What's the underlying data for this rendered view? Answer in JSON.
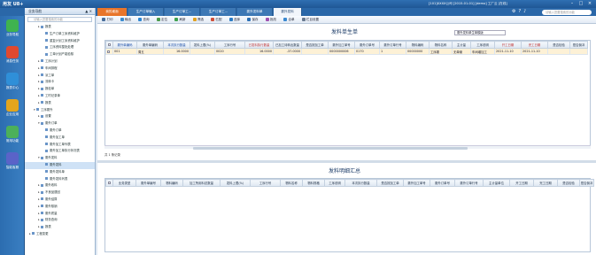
{
  "app": {
    "logo": "用友 U8+",
    "titlebar_info": "[101]XXXX公司 [2015-01-01] [demo] 工厂云 [在线]"
  },
  "top": {
    "search_placeholder": "请输入您要搜索的功能"
  },
  "modules": [
    {
      "label": "业务导航",
      "color": "#3fb34f"
    },
    {
      "label": "消息任务",
      "color": "#e0492f"
    },
    {
      "label": "报表中心",
      "color": "#2f8fd8"
    },
    {
      "label": "企业应用",
      "color": "#e3a51c"
    },
    {
      "label": "常用功能",
      "color": "#4cb05a"
    },
    {
      "label": "智能客服",
      "color": "#5a63c8"
    }
  ],
  "tree": {
    "header": "业务导航",
    "search_placeholder": "请输入您要搜索的功能",
    "nodes": [
      {
        "label": "报表",
        "indent": 3,
        "toggle": "+"
      },
      {
        "label": "生产订单工序资料维护",
        "indent": 4,
        "toggle": ""
      },
      {
        "label": "重复计划工序资料维护",
        "indent": 4,
        "toggle": ""
      },
      {
        "label": "工序资料整批处理",
        "indent": 4,
        "toggle": ""
      },
      {
        "label": "工单计划产能检核",
        "indent": 4,
        "toggle": ""
      },
      {
        "label": "工序计划",
        "indent": 3,
        "toggle": "+"
      },
      {
        "label": "车间排程",
        "indent": 3,
        "toggle": "+"
      },
      {
        "label": "派工单",
        "indent": 3,
        "toggle": "+"
      },
      {
        "label": "流转卡",
        "indent": 3,
        "toggle": "+"
      },
      {
        "label": "报检单",
        "indent": 3,
        "toggle": "+"
      },
      {
        "label": "工时记录单",
        "indent": 3,
        "toggle": "+"
      },
      {
        "label": "报表",
        "indent": 3,
        "toggle": "+"
      },
      {
        "label": "工序委外",
        "indent": 2,
        "toggle": "-"
      },
      {
        "label": "设置",
        "indent": 3,
        "toggle": "+"
      },
      {
        "label": "委外订单",
        "indent": 3,
        "toggle": "-"
      },
      {
        "label": "委外订单",
        "indent": 4,
        "toggle": ""
      },
      {
        "label": "委外加工单",
        "indent": 4,
        "toggle": ""
      },
      {
        "label": "委外加工单列表",
        "indent": 4,
        "toggle": ""
      },
      {
        "label": "委外加工单执行状况表",
        "indent": 4,
        "toggle": ""
      },
      {
        "label": "委外发料",
        "indent": 3,
        "toggle": "-"
      },
      {
        "label": "委外发料",
        "indent": 4,
        "toggle": "",
        "selected": true
      },
      {
        "label": "委外发料单",
        "indent": 4,
        "toggle": ""
      },
      {
        "label": "委外发料列表",
        "indent": 4,
        "toggle": ""
      },
      {
        "label": "委外收料",
        "indent": 3,
        "toggle": "+"
      },
      {
        "label": "不良品退回",
        "indent": 3,
        "toggle": "+"
      },
      {
        "label": "委外结算",
        "indent": 3,
        "toggle": "+"
      },
      {
        "label": "委外核销",
        "indent": 3,
        "toggle": "+"
      },
      {
        "label": "委外质量",
        "indent": 3,
        "toggle": "+"
      },
      {
        "label": "财务查询",
        "indent": 3,
        "toggle": "+"
      },
      {
        "label": "报表",
        "indent": 3,
        "toggle": "+"
      },
      {
        "label": "工程变更",
        "indent": 1,
        "toggle": "+"
      }
    ]
  },
  "tabs": [
    {
      "label": "我的桌面",
      "style": "red",
      "w": 34
    },
    {
      "label": "生产订单输入",
      "style": "",
      "w": 40
    },
    {
      "label": "生产订单工...",
      "style": "",
      "w": 40
    },
    {
      "label": "生产订单工...",
      "style": "",
      "w": 40
    },
    {
      "label": "委外发料单",
      "style": "",
      "w": 40
    },
    {
      "label": "委外发料",
      "style": "active",
      "w": 32
    }
  ],
  "toolbar": [
    {
      "label": "打印",
      "color": "#4a6e9a"
    },
    {
      "label": "输出",
      "color": "#3a8bd0"
    },
    {
      "label": "查询",
      "color": "#2f86d0"
    },
    {
      "label": "定位",
      "color": "#4a9a4a"
    },
    {
      "label": "刷新",
      "color": "#3fa14f"
    },
    {
      "label": "筛选",
      "color": "#e0a020"
    },
    {
      "label": "匹配",
      "color": "#d0503a"
    },
    {
      "label": "选择",
      "color": "#2b7bc4"
    },
    {
      "label": "保存",
      "color": "#2b6fb5"
    },
    {
      "label": "批改",
      "color": "#a050b0"
    },
    {
      "label": "合单",
      "color": "#3a88d0"
    },
    {
      "label": "栏目设置",
      "color": "#6a7a90"
    }
  ],
  "form1": {
    "title": "发料单生单",
    "view": "委外发料单生单模版",
    "columns": [
      "",
      "委外单编码",
      "委外单编码",
      "本次执行数量",
      "发料上限(%)",
      "工序行号",
      "已发料执行数量",
      "已加工待转出数量",
      "是否按加工单",
      "委外加工单号",
      "委外订单号",
      "委外订单行号",
      "物料编码",
      "物料名称",
      "主计量",
      "工序说明",
      "开工日期",
      "完工日期",
      "是否检验",
      "是否倒冲"
    ],
    "col_style": [
      "",
      "blue",
      "",
      "blue",
      "",
      "",
      "red",
      "",
      "",
      "",
      "",
      "",
      "",
      "",
      "",
      "",
      "red",
      "red",
      "",
      ""
    ],
    "col_w": [
      8,
      27,
      30,
      30,
      28,
      34,
      32,
      32,
      30,
      30,
      28,
      30,
      26,
      26,
      21,
      27,
      30,
      30,
      25,
      20
    ],
    "rows": [
      [
        "",
        "001",
        "周五",
        "16.0000",
        "",
        "0020",
        "16.0000",
        "-37.0000",
        "",
        "0000000006",
        "0170",
        "1",
        "00000000",
        "工序委",
        "无单案",
        "车间增加工",
        "2021-11-10",
        "2021-11-10",
        "",
        ""
      ]
    ],
    "records": "共 1 条记录"
  },
  "form2": {
    "title": "发料明细汇总",
    "columns": [
      "",
      "业务类型",
      "委外单编号",
      "物料编码",
      "加工所用料总数量",
      "发料上限(%)",
      "工序行号",
      "物料名称",
      "物料规格",
      "工序说明",
      "本次执行数量",
      "是否按加工单",
      "委外加工单号",
      "委外订单号",
      "委外订单行号",
      "主计量单位",
      "开工日期",
      "完工日期",
      "是否检验",
      "是否倒冲"
    ],
    "col_w": [
      8,
      26,
      28,
      25,
      42,
      34,
      34,
      25,
      25,
      23,
      36,
      30,
      30,
      28,
      32,
      30,
      27,
      27,
      25,
      16
    ]
  }
}
